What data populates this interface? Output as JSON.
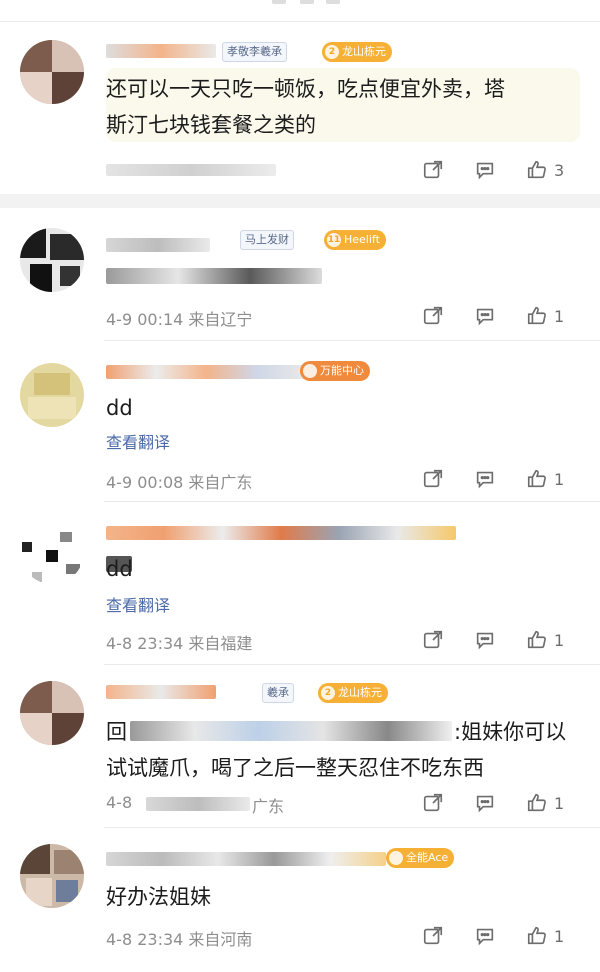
{
  "colors": {
    "accent_link": "#4b6aa8",
    "meta_gray": "#8e8e8e",
    "badge_gold": "#f5b035",
    "bubble_bg": "#fbf8ec"
  },
  "comments": [
    {
      "tags": [
        "孝敬李羲承"
      ],
      "badge": {
        "level": "2",
        "label": "龙山栋元"
      },
      "text_lines": [
        "还可以一天只吃一顿饭，吃点便宜外卖，塔",
        "斯汀七块钱套餐之类的"
      ],
      "time": "",
      "location": "",
      "likes": "3"
    },
    {
      "tags": [
        "马上发财"
      ],
      "badge": {
        "level": "11",
        "label": "Heelift"
      },
      "text_lines": [],
      "time": "4-9 00:14",
      "location": "来自辽宁",
      "likes": "1"
    },
    {
      "tags": [],
      "badge": {
        "level": "",
        "label": "万能中心"
      },
      "text_lines": [
        "dd"
      ],
      "translate": "查看翻译",
      "time": "4-9 00:08",
      "location": "来自广东",
      "likes": "1"
    },
    {
      "tags": [],
      "badge": {
        "level": "",
        "label": ""
      },
      "text_lines": [
        "dd"
      ],
      "translate": "查看翻译",
      "time": "4-8 23:34",
      "location": "来自福建",
      "likes": "1"
    },
    {
      "tags": [
        "羲承"
      ],
      "badge": {
        "level": "2",
        "label": "龙山栋元"
      },
      "reply_prefix": "回",
      "text_lines": [
        ":姐妹你可以",
        "试试魔爪，喝了之后一整天忍住不吃东西"
      ],
      "time": "4-8",
      "location": "广东",
      "likes": "1"
    },
    {
      "tags": [],
      "badge": {
        "level": "",
        "label": "全能Ace"
      },
      "text_lines": [
        "好办法姐妹"
      ],
      "time": "4-8 23:34",
      "location": "来自河南",
      "likes": "1"
    }
  ]
}
